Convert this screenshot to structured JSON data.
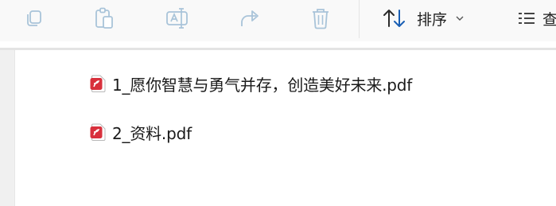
{
  "toolbar": {
    "buttons": [
      {
        "name": "copy",
        "icon": "copy-icon"
      },
      {
        "name": "paste",
        "icon": "paste-icon"
      },
      {
        "name": "rename",
        "icon": "rename-icon"
      },
      {
        "name": "share",
        "icon": "share-icon"
      },
      {
        "name": "delete",
        "icon": "trash-icon"
      }
    ],
    "sort_label": "排序",
    "sort_icon": "sort-arrows-icon",
    "view_icon": "view-list-icon",
    "view_label": "查"
  },
  "files": [
    {
      "name": "1_愿你智慧与勇气并存，创造美好未来.pdf",
      "icon": "pdf-icon"
    },
    {
      "name": "2_资料.pdf",
      "icon": "pdf-icon"
    }
  ],
  "colors": {
    "toolbar_bg": "#f9f9f9",
    "icon_disabled": "#a9c4d9",
    "pdf_red": "#d8303c",
    "text": "#1a1a1a"
  }
}
